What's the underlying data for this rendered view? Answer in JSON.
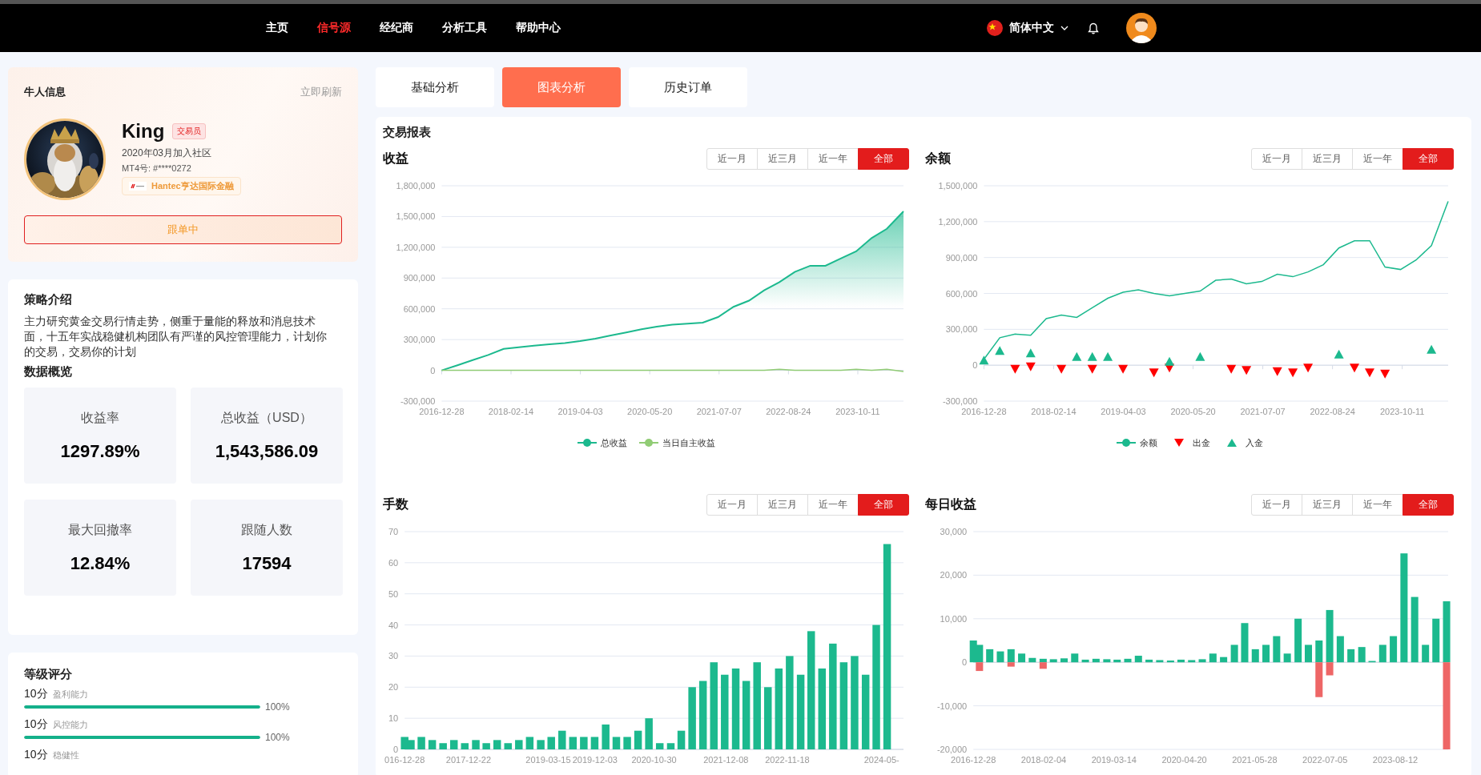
{
  "nav": {
    "items": [
      {
        "label": "主页",
        "selected": false
      },
      {
        "label": "信号源",
        "selected": true
      },
      {
        "label": "经纪商",
        "selected": false
      },
      {
        "label": "分析工具",
        "selected": false
      },
      {
        "label": "帮助中心",
        "selected": false
      }
    ],
    "language": "简体中文"
  },
  "profile_card": {
    "title": "牛人信息",
    "refresh": "立即刷新",
    "name": "King",
    "badge": "交易员",
    "joined": "2020年03月加入社区",
    "mt4": "MT4号: #****0272",
    "broker": "Hantec亨达国际金融",
    "follow_button": "跟单中"
  },
  "strategy_card": {
    "title": "策略介绍",
    "description": "主力研究黄金交易行情走势，侧重于量能的释放和消息技术面，十五年实战稳健机构团队有严谨的风控管理能力，计划你的交易，交易你的计划",
    "overview_title": "数据概览",
    "stats": [
      {
        "label": "收益率",
        "value": "1297.89%"
      },
      {
        "label": "总收益（USD）",
        "value": "1,543,586.09"
      },
      {
        "label": "最大回撤率",
        "value": "12.84%"
      },
      {
        "label": "跟随人数",
        "value": "17594"
      }
    ]
  },
  "rating_card": {
    "title": "等级评分",
    "items": [
      {
        "score": "10分",
        "label": "盈利能力",
        "level": 1,
        "percent": "100%"
      },
      {
        "score": "10分",
        "label": "风控能力",
        "level": 1,
        "percent": "100%"
      },
      {
        "score": "10分",
        "label": "稳健性"
      }
    ]
  },
  "tabs": [
    {
      "label": "基础分析",
      "selected": false
    },
    {
      "label": "图表分析",
      "selected": true
    },
    {
      "label": "历史订单",
      "selected": false
    }
  ],
  "report": {
    "title": "交易报表",
    "charts": [
      {
        "title": "收益",
        "ranges": [
          {
            "label": "近一月",
            "selected": false
          },
          {
            "label": "近三月",
            "selected": false
          },
          {
            "label": "近一年",
            "selected": false
          },
          {
            "label": "全部",
            "selected": true
          }
        ],
        "chart_data": {
          "type": "line",
          "grid": true,
          "legend": "bottom",
          "x": [
            "2016-12-28",
            "2017-04-01",
            "2017-07-01",
            "2017-10-01",
            "2018-01-01",
            "2018-04-01",
            "2018-07-01",
            "2018-10-01",
            "2019-01-01",
            "2019-04-01",
            "2019-07-01",
            "2019-10-01",
            "2020-01-01",
            "2020-04-01",
            "2020-07-01",
            "2020-10-01",
            "2021-01-01",
            "2021-04-01",
            "2021-07-01",
            "2021-10-01",
            "2022-01-01",
            "2022-04-01",
            "2022-07-01",
            "2022-10-01",
            "2023-01-01",
            "2023-04-01",
            "2023-07-01",
            "2023-10-01",
            "2024-01-01",
            "2024-04-01",
            "2024-07-09"
          ],
          "series": [
            {
              "name": "总收益",
              "type": "area",
              "color": "#1cb98e",
              "values": [
                0,
                50000,
                100000,
                150000,
                210000,
                225000,
                240000,
                255000,
                265000,
                285000,
                310000,
                340000,
                370000,
                400000,
                425000,
                445000,
                455000,
                465000,
                520000,
                620000,
                680000,
                780000,
                860000,
                960000,
                1020000,
                1020000,
                1090000,
                1160000,
                1290000,
                1380000,
                1550000
              ]
            },
            {
              "name": "当日自主收益",
              "type": "line",
              "color": "#91cc75",
              "values": [
                0,
                0,
                0,
                0,
                0,
                0,
                0,
                0,
                0,
                0,
                0,
                0,
                0,
                0,
                0,
                0,
                0,
                0,
                0,
                0,
                0,
                0,
                10000,
                0,
                0,
                0,
                0,
                10000,
                0,
                10000,
                -10000
              ]
            }
          ],
          "xlim": [
            "2016-12-28",
            "2024-07-09"
          ],
          "ylim": [
            -300000,
            1800000
          ],
          "xticks": [
            "2016-12-28",
            "2018-02-14",
            "2019-04-03",
            "2020-05-20",
            "2021-07-07",
            "2022-08-24",
            "2023-10-11"
          ],
          "yticks": [
            {
              "value": -300000,
              "label": "-300,000"
            },
            {
              "value": 0,
              "label": "0"
            },
            {
              "value": 300000,
              "label": "300,000"
            },
            {
              "value": 600000,
              "label": "600,000"
            },
            {
              "value": 900000,
              "label": "900,000"
            },
            {
              "value": 1200000,
              "label": "1,200,000"
            },
            {
              "value": 1500000,
              "label": "1,500,000"
            },
            {
              "value": 1800000,
              "label": "1,800,000"
            }
          ]
        }
      },
      {
        "title": "余额",
        "ranges": [
          {
            "label": "近一月",
            "selected": false
          },
          {
            "label": "近三月",
            "selected": false
          },
          {
            "label": "近一年",
            "selected": false
          },
          {
            "label": "全部",
            "selected": true
          }
        ],
        "chart_data": {
          "type": "line",
          "grid": true,
          "legend": "bottom",
          "x": [
            "2016-12-28",
            "2017-04-01",
            "2017-07-01",
            "2017-10-01",
            "2018-01-01",
            "2018-04-01",
            "2018-07-01",
            "2018-10-01",
            "2019-01-01",
            "2019-04-01",
            "2019-07-01",
            "2019-10-01",
            "2020-01-01",
            "2020-04-01",
            "2020-07-01",
            "2020-10-01",
            "2021-01-01",
            "2021-04-01",
            "2021-07-01",
            "2021-10-01",
            "2022-01-01",
            "2022-04-01",
            "2022-07-01",
            "2022-10-01",
            "2023-01-01",
            "2023-04-01",
            "2023-07-01",
            "2023-10-01",
            "2024-01-01",
            "2024-04-01",
            "2024-07-09"
          ],
          "series": [
            {
              "name": "余额",
              "type": "line",
              "color": "#1cb98e",
              "values": [
                50000,
                230000,
                260000,
                250000,
                390000,
                420000,
                400000,
                480000,
                560000,
                610000,
                630000,
                600000,
                580000,
                600000,
                620000,
                710000,
                720000,
                680000,
                700000,
                760000,
                740000,
                780000,
                840000,
                980000,
                1040000,
                1040000,
                820000,
                800000,
                880000,
                1000000,
                1370000
              ]
            },
            {
              "name": "出金",
              "type": "scatter",
              "color": "#ff0000",
              "values": [
                null,
                null,
                -30000,
                -10000,
                null,
                -30000,
                null,
                -30000,
                null,
                -30000,
                null,
                -60000,
                -20000,
                null,
                null,
                null,
                -30000,
                -40000,
                null,
                -50000,
                -60000,
                -20000,
                null,
                null,
                -20000,
                -60000,
                -70000,
                null,
                null,
                null,
                null
              ]
            },
            {
              "name": "入金",
              "type": "scatter",
              "color": "#1cb98e",
              "values": [
                40000,
                120000,
                null,
                100000,
                null,
                null,
                70000,
                70000,
                70000,
                null,
                null,
                null,
                30000,
                null,
                70000,
                null,
                null,
                null,
                null,
                null,
                null,
                null,
                null,
                90000,
                null,
                null,
                null,
                null,
                null,
                130000,
                null
              ]
            }
          ],
          "xlim": [
            "2016-12-28",
            "2024-07-09"
          ],
          "ylim": [
            -300000,
            1500000
          ],
          "xticks": [
            "2016-12-28",
            "2018-02-14",
            "2019-04-03",
            "2020-05-20",
            "2021-07-07",
            "2022-08-24",
            "2023-10-11"
          ],
          "yticks": [
            {
              "value": -300000,
              "label": "-300,000"
            },
            {
              "value": 0,
              "label": "0"
            },
            {
              "value": 300000,
              "label": "300,000"
            },
            {
              "value": 600000,
              "label": "600,000"
            },
            {
              "value": 900000,
              "label": "900,000"
            },
            {
              "value": 1200000,
              "label": "1,200,000"
            },
            {
              "value": 1500000,
              "label": "1,500,000"
            }
          ]
        }
      },
      {
        "title": "手数",
        "ranges": [
          {
            "label": "近一月",
            "selected": false
          },
          {
            "label": "近三月",
            "selected": false
          },
          {
            "label": "近一年",
            "selected": false
          },
          {
            "label": "全部",
            "selected": true
          }
        ],
        "chart_data": {
          "type": "bar",
          "grid": true,
          "x": [
            "2016-12-28",
            "2017-02-01",
            "2017-04-01",
            "2017-06-01",
            "2017-08-01",
            "2017-10-01",
            "2017-12-01",
            "2018-02-01",
            "2018-04-01",
            "2018-06-01",
            "2018-08-01",
            "2018-10-01",
            "2018-12-01",
            "2019-02-01",
            "2019-04-01",
            "2019-06-01",
            "2019-08-01",
            "2019-10-01",
            "2019-12-01",
            "2020-02-01",
            "2020-04-01",
            "2020-06-01",
            "2020-08-01",
            "2020-10-01",
            "2020-12-01",
            "2021-02-01",
            "2021-04-01",
            "2021-06-01",
            "2021-08-01",
            "2021-10-01",
            "2021-12-01",
            "2022-02-01",
            "2022-04-01",
            "2022-06-01",
            "2022-08-01",
            "2022-10-01",
            "2022-12-01",
            "2023-02-01",
            "2023-04-01",
            "2023-06-01",
            "2023-08-01",
            "2023-10-01",
            "2023-12-01",
            "2024-02-01",
            "2024-04-01",
            "2024-06-01"
          ],
          "series": [
            {
              "color": "#1cb98e",
              "values": [
                4,
                3,
                4,
                3,
                2,
                3,
                2,
                3,
                2,
                3,
                2,
                3,
                4,
                3,
                4,
                6,
                4,
                4,
                4,
                8,
                4,
                4,
                6,
                10,
                2,
                2,
                6,
                20,
                22,
                28,
                24,
                26,
                22,
                28,
                20,
                26,
                30,
                24,
                38,
                26,
                34,
                28,
                30,
                24,
                40,
                66
              ]
            }
          ],
          "xlim": [
            "2016-12-28",
            "2024-09-01"
          ],
          "ylim": [
            0,
            70
          ],
          "xticks": [
            {
              "value": "2016-12-28",
              "label": "016-12-28"
            },
            {
              "value": "2017-12-22",
              "label": "2017-12-22"
            },
            {
              "value": "2019-03-15",
              "label": "2019-03-15"
            },
            {
              "value": "2019-12-03",
              "label": "2019-12-03"
            },
            {
              "value": "2020-10-30",
              "label": "2020-10-30"
            },
            {
              "value": "2021-12-08",
              "label": "2021-12-08"
            },
            {
              "value": "2022-11-18",
              "label": "2022-11-18"
            },
            {
              "value": "2024-05-01",
              "label": "2024-05-"
            }
          ],
          "yticks": [
            0,
            10,
            20,
            30,
            40,
            50,
            60,
            70
          ]
        }
      },
      {
        "title": "每日收益",
        "ranges": [
          {
            "label": "近一月",
            "selected": false
          },
          {
            "label": "近三月",
            "selected": false
          },
          {
            "label": "近一年",
            "selected": false
          },
          {
            "label": "全部",
            "selected": true
          }
        ],
        "chart_data": {
          "type": "bar",
          "grid": true,
          "stacked": true,
          "x": [
            "2016-12-28",
            "2017-02-01",
            "2017-04-01",
            "2017-06-01",
            "2017-08-01",
            "2017-10-01",
            "2017-12-01",
            "2018-02-01",
            "2018-04-01",
            "2018-06-01",
            "2018-08-01",
            "2018-10-01",
            "2018-12-01",
            "2019-02-01",
            "2019-04-01",
            "2019-06-01",
            "2019-08-01",
            "2019-10-01",
            "2019-12-01",
            "2020-02-01",
            "2020-04-01",
            "2020-06-01",
            "2020-08-01",
            "2020-10-01",
            "2020-12-01",
            "2021-02-01",
            "2021-04-01",
            "2021-06-01",
            "2021-08-01",
            "2021-10-01",
            "2021-12-01",
            "2022-02-01",
            "2022-04-01",
            "2022-06-01",
            "2022-08-01",
            "2022-10-01",
            "2022-12-01",
            "2023-02-01",
            "2023-04-01",
            "2023-06-01",
            "2023-08-01",
            "2023-10-01",
            "2023-12-01",
            "2024-02-01",
            "2024-04-01",
            "2024-06-01"
          ],
          "series": [
            {
              "color": "#1cb98e",
              "values": [
                5000,
                4000,
                3000,
                2500,
                3000,
                2000,
                1000,
                800,
                700,
                900,
                2000,
                600,
                800,
                700,
                600,
                800,
                1500,
                600,
                500,
                400,
                600,
                500,
                700,
                2000,
                1200,
                4000,
                9000,
                3000,
                4000,
                6000,
                2000,
                10000,
                4000,
                5000,
                12000,
                6000,
                3000,
                3500,
                300,
                4000,
                6000,
                25000,
                15000,
                4000,
                10000,
                14000
              ]
            },
            {
              "color": "#ee6666",
              "values": [
                null,
                -2000,
                null,
                null,
                -1000,
                null,
                null,
                -1500,
                null,
                null,
                null,
                null,
                null,
                null,
                null,
                null,
                null,
                null,
                null,
                null,
                null,
                null,
                null,
                null,
                null,
                null,
                null,
                null,
                null,
                null,
                null,
                null,
                null,
                -8000,
                -3000,
                null,
                null,
                null,
                null,
                null,
                null,
                null,
                null,
                null,
                null,
                -20000
              ]
            }
          ],
          "xlim": [
            "2016-12-28",
            "2024-06-10"
          ],
          "ylim": [
            -20000,
            30000
          ],
          "xticks": [
            "2016-12-28",
            "2018-02-04",
            "2019-03-14",
            "2020-04-20",
            "2021-05-28",
            "2022-07-05",
            "2023-08-12"
          ],
          "yticks": [
            {
              "value": -20000,
              "label": "-20,000"
            },
            {
              "value": -10000,
              "label": "-10,000"
            },
            {
              "value": 0,
              "label": "0"
            },
            {
              "value": 10000,
              "label": "10,000"
            },
            {
              "value": 20000,
              "label": "20,000"
            },
            {
              "value": 30000,
              "label": "30,000"
            }
          ]
        }
      }
    ]
  }
}
